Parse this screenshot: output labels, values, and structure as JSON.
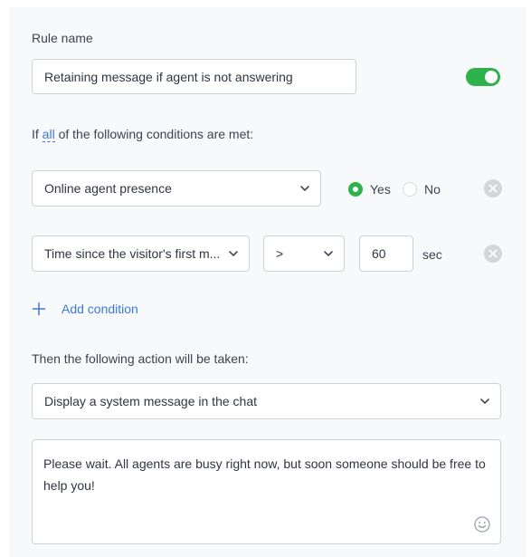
{
  "rule": {
    "name_label": "Rule name",
    "name_value": "Retaining message if agent is not answering",
    "enabled": true
  },
  "conditions_header": {
    "prefix": "If",
    "match_mode": "all",
    "suffix": "of the following conditions are met:"
  },
  "conditions": [
    {
      "field": "Online agent presence",
      "options": {
        "yes": "Yes",
        "no": "No",
        "selected": "yes"
      }
    },
    {
      "field": "Time since the visitor's first m...",
      "operator": ">",
      "value": "60",
      "unit": "sec"
    }
  ],
  "add_condition_label": "Add condition",
  "action": {
    "header": "Then the following action will be taken:",
    "type": "Display a system message in the chat",
    "message": "Please wait. All agents are busy right now, but soon someone should be free to help you!"
  },
  "colors": {
    "accent_green": "#2eb24b",
    "link_blue": "#3a7bd5",
    "background": "#f8f9fb"
  }
}
